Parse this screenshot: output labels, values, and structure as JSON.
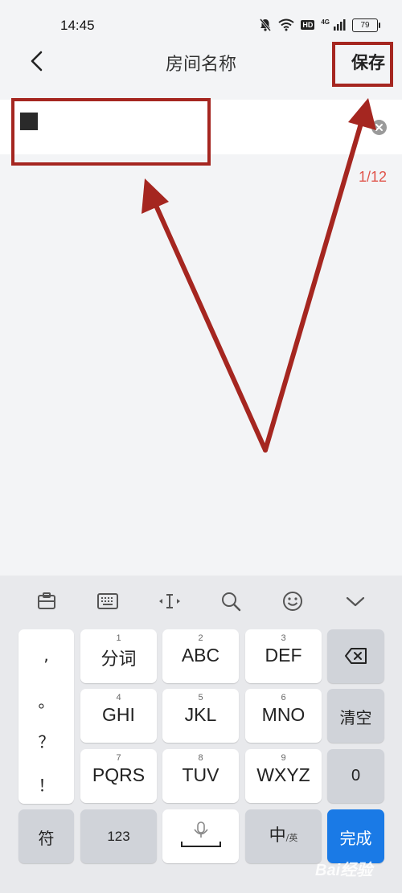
{
  "status_bar": {
    "time": "14:45",
    "battery": "79",
    "hd": "HD",
    "signal_label": "4G"
  },
  "header": {
    "title": "房间名称",
    "save_label": "保存"
  },
  "input": {
    "value": "",
    "counter": "1/12"
  },
  "keyboard": {
    "toolbar": [
      "clipboard-icon",
      "keyboard-icon",
      "cursor-icon",
      "search-icon",
      "emoji-icon",
      "collapse-icon"
    ],
    "symbols": [
      ",",
      "。",
      "？",
      "！"
    ],
    "keys": [
      {
        "num": "1",
        "label": "分词"
      },
      {
        "num": "2",
        "label": "ABC"
      },
      {
        "num": "3",
        "label": "DEF"
      },
      {
        "num": "4",
        "label": "GHI"
      },
      {
        "num": "5",
        "label": "JKL"
      },
      {
        "num": "6",
        "label": "MNO"
      },
      {
        "num": "7",
        "label": "PQRS"
      },
      {
        "num": "8",
        "label": "TUV"
      },
      {
        "num": "9",
        "label": "WXYZ"
      }
    ],
    "clear_label": "清空",
    "zero_label": "0",
    "symbol_label": "符",
    "num_label": "123",
    "lang_main": "中",
    "lang_sub": "/英",
    "done_label": "完成"
  },
  "watermark": "Bai经验",
  "colors": {
    "highlight": "#a52620",
    "counter": "#e0534a",
    "done": "#1a7ae6"
  }
}
